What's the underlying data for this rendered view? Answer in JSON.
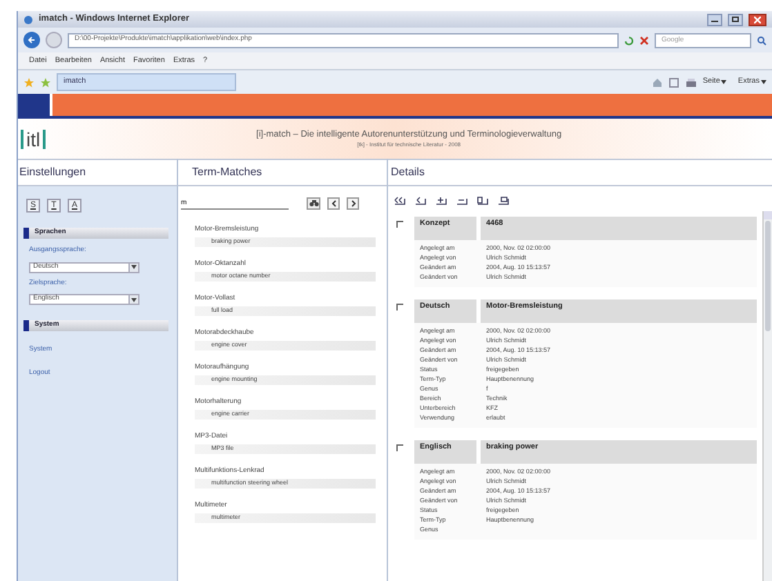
{
  "browser": {
    "title": "imatch - Windows Internet Explorer",
    "address": "D:\\00-Projekte\\Produkte\\imatch\\applikation\\web\\index.php",
    "search_placeholder": "Google",
    "menu": [
      "Datei",
      "Bearbeiten",
      "Ansicht",
      "Favoriten",
      "Extras",
      "?"
    ],
    "tab": "imatch",
    "toolbar_items": [
      "Seite",
      "Extras"
    ]
  },
  "header": {
    "logo": "itl",
    "title": "[i]-match – Die intelligente Autorenunterstützung und Terminologieverwaltung",
    "subtitle": "[tk] - Institut für technische Literatur - 2008"
  },
  "settings": {
    "heading": "Einstellungen",
    "mode_buttons": [
      "S",
      "T",
      "A"
    ],
    "sections": [
      {
        "title": "Sprachen",
        "items": [
          {
            "kind": "label",
            "text": "Ausgangssprache:"
          },
          {
            "kind": "select",
            "text": "Deutsch"
          },
          {
            "kind": "label",
            "text": "Zielsprache:"
          },
          {
            "kind": "select",
            "text": "Englisch"
          }
        ]
      },
      {
        "title": "System",
        "items": [
          {
            "kind": "link",
            "text": "System"
          },
          {
            "kind": "link",
            "text": "Logout"
          }
        ]
      }
    ]
  },
  "term_matches": {
    "heading": "Term-Matches",
    "search_value": "m",
    "entries": [
      {
        "term": "Motor-Bremsleistung",
        "translation": "braking power"
      },
      {
        "term": "Motor-Oktanzahl",
        "translation": "motor octane number"
      },
      {
        "term": "Motor-Vollast",
        "translation": "full load"
      },
      {
        "term": "Motorabdeckhaube",
        "translation": "engine cover"
      },
      {
        "term": "Motoraufhängung",
        "translation": "engine mounting"
      },
      {
        "term": "Motorhalterung",
        "translation": "engine carrier"
      },
      {
        "term": "MP3-Datei",
        "translation": "MP3 file"
      },
      {
        "term": "Multifunktions-Lenkrad",
        "translation": "multifunction steering wheel"
      },
      {
        "term": "Multimeter",
        "translation": "multimeter"
      }
    ]
  },
  "details": {
    "heading": "Details",
    "blocks": [
      {
        "checked": false,
        "label": "Konzept",
        "value": "4468",
        "rows": [
          {
            "label": "Angelegt am",
            "value": "2000, Nov. 02 02:00:00"
          },
          {
            "label": "Angelegt von",
            "value": "Ulrich Schmidt"
          },
          {
            "label": "Geändert am",
            "value": "2004, Aug. 10 15:13:57"
          },
          {
            "label": "Geändert von",
            "value": "Ulrich Schmidt"
          }
        ]
      },
      {
        "checked": false,
        "label": "Deutsch",
        "value": "Motor-Bremsleistung",
        "rows": [
          {
            "label": "Angelegt am",
            "value": "2000, Nov. 02 02:00:00"
          },
          {
            "label": "Angelegt von",
            "value": "Ulrich Schmidt"
          },
          {
            "label": "Geändert am",
            "value": "2004, Aug. 10 15:13:57"
          },
          {
            "label": "Geändert von",
            "value": "Ulrich Schmidt"
          },
          {
            "label": "Status",
            "value": "freigegeben"
          },
          {
            "label": "Term-Typ",
            "value": "Hauptbenennung"
          },
          {
            "label": "Genus",
            "value": "f"
          },
          {
            "label": "Bereich",
            "value": "Technik"
          },
          {
            "label": "Unterbereich",
            "value": "KFZ"
          },
          {
            "label": "Verwendung",
            "value": "erlaubt"
          }
        ]
      },
      {
        "checked": false,
        "label": "Englisch",
        "value": "braking power",
        "rows": [
          {
            "label": "Angelegt am",
            "value": "2000, Nov. 02 02:00:00"
          },
          {
            "label": "Angelegt von",
            "value": "Ulrich Schmidt"
          },
          {
            "label": "Geändert am",
            "value": "2004, Aug. 10 15:13:57"
          },
          {
            "label": "Geändert von",
            "value": "Ulrich Schmidt"
          },
          {
            "label": "Status",
            "value": "freigegeben"
          },
          {
            "label": "Term-Typ",
            "value": "Hauptbenennung"
          },
          {
            "label": "Genus"
          }
        ]
      }
    ]
  }
}
